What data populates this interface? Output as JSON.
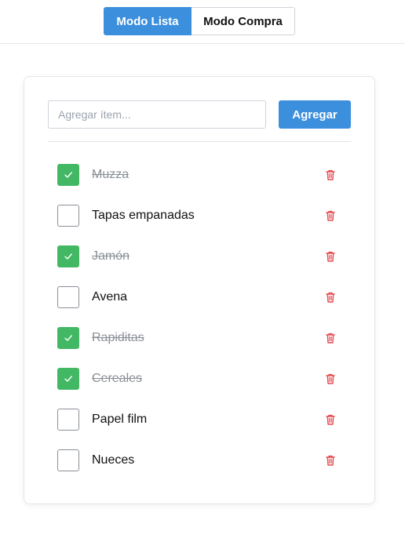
{
  "header": {
    "modes": [
      {
        "label": "Modo Lista",
        "active": true
      },
      {
        "label": "Modo Compra",
        "active": false
      }
    ]
  },
  "add_form": {
    "placeholder": "Agregar ítem...",
    "value": "",
    "button_label": "Agregar"
  },
  "items": [
    {
      "label": "Muzza",
      "checked": true
    },
    {
      "label": "Tapas empanadas",
      "checked": false
    },
    {
      "label": "Jamón",
      "checked": true
    },
    {
      "label": "Avena",
      "checked": false
    },
    {
      "label": "Rapiditas",
      "checked": true
    },
    {
      "label": "Cereales",
      "checked": true
    },
    {
      "label": "Papel film",
      "checked": false
    },
    {
      "label": "Nueces",
      "checked": false
    }
  ],
  "icons": {
    "check": "check-icon",
    "delete": "trash-icon"
  },
  "colors": {
    "primary": "#3b8fdd",
    "checked": "#43b864",
    "delete": "#e5484d",
    "done_text": "#8a8f96"
  }
}
